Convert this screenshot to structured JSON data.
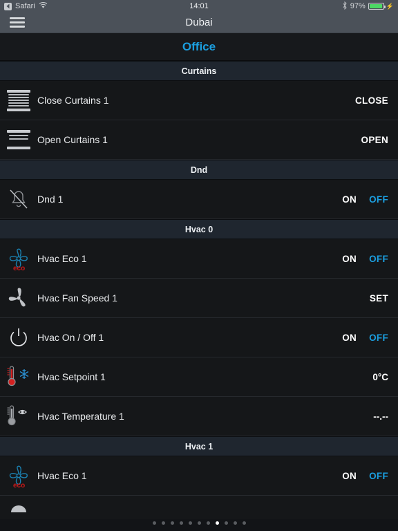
{
  "status_bar": {
    "back_app": "Safari",
    "back_icon": "back-arrow-icon",
    "wifi_icon": "wifi-icon",
    "time": "14:01",
    "bluetooth_icon": "bluetooth-icon",
    "battery_percent": "97%",
    "battery_icon": "battery-charging-icon",
    "battery_level": 97,
    "battery_color": "#4cd964"
  },
  "navbar": {
    "menu_icon": "hamburger-menu-icon",
    "title": "Dubai"
  },
  "room": {
    "title": "Office",
    "accent_color": "#1b9fe0"
  },
  "sections": [
    {
      "title": "Curtains",
      "rows": [
        {
          "icon": "curtain-closed-icon",
          "label": "Close Curtains 1",
          "actions": [
            {
              "text": "CLOSE",
              "style": "white"
            }
          ]
        },
        {
          "icon": "curtain-open-icon",
          "label": "Open Curtains 1",
          "actions": [
            {
              "text": "OPEN",
              "style": "white"
            }
          ]
        }
      ]
    },
    {
      "title": "Dnd",
      "rows": [
        {
          "icon": "bell-slash-icon",
          "label": "Dnd 1",
          "actions": [
            {
              "text": "ON",
              "style": "white"
            },
            {
              "text": "OFF",
              "style": "blue"
            }
          ]
        }
      ]
    },
    {
      "title": "Hvac 0",
      "rows": [
        {
          "icon": "fan-eco-icon",
          "label": "Hvac Eco 1",
          "actions": [
            {
              "text": "ON",
              "style": "white"
            },
            {
              "text": "OFF",
              "style": "blue"
            }
          ]
        },
        {
          "icon": "fan-speed-icon",
          "label": "Hvac Fan Speed 1",
          "actions": [
            {
              "text": "SET",
              "style": "white"
            }
          ]
        },
        {
          "icon": "power-icon",
          "label": "Hvac On / Off 1",
          "actions": [
            {
              "text": "ON",
              "style": "white"
            },
            {
              "text": "OFF",
              "style": "blue"
            }
          ]
        },
        {
          "icon": "thermometer-snowflake-icon",
          "label": "Hvac Setpoint 1",
          "actions": [
            {
              "text": "0°C",
              "style": "value"
            }
          ]
        },
        {
          "icon": "thermometer-eye-icon",
          "label": "Hvac Temperature 1",
          "actions": [
            {
              "text": "--.--",
              "style": "value"
            }
          ]
        }
      ]
    },
    {
      "title": "Hvac 1",
      "rows": [
        {
          "icon": "fan-eco-icon",
          "label": "Hvac Eco 1",
          "actions": [
            {
              "text": "ON",
              "style": "white"
            },
            {
              "text": "OFF",
              "style": "blue"
            }
          ]
        },
        {
          "icon": "partial-dome-icon",
          "label": "",
          "partial": true,
          "actions": []
        }
      ]
    }
  ],
  "pagination": {
    "total": 11,
    "active_index": 7
  }
}
